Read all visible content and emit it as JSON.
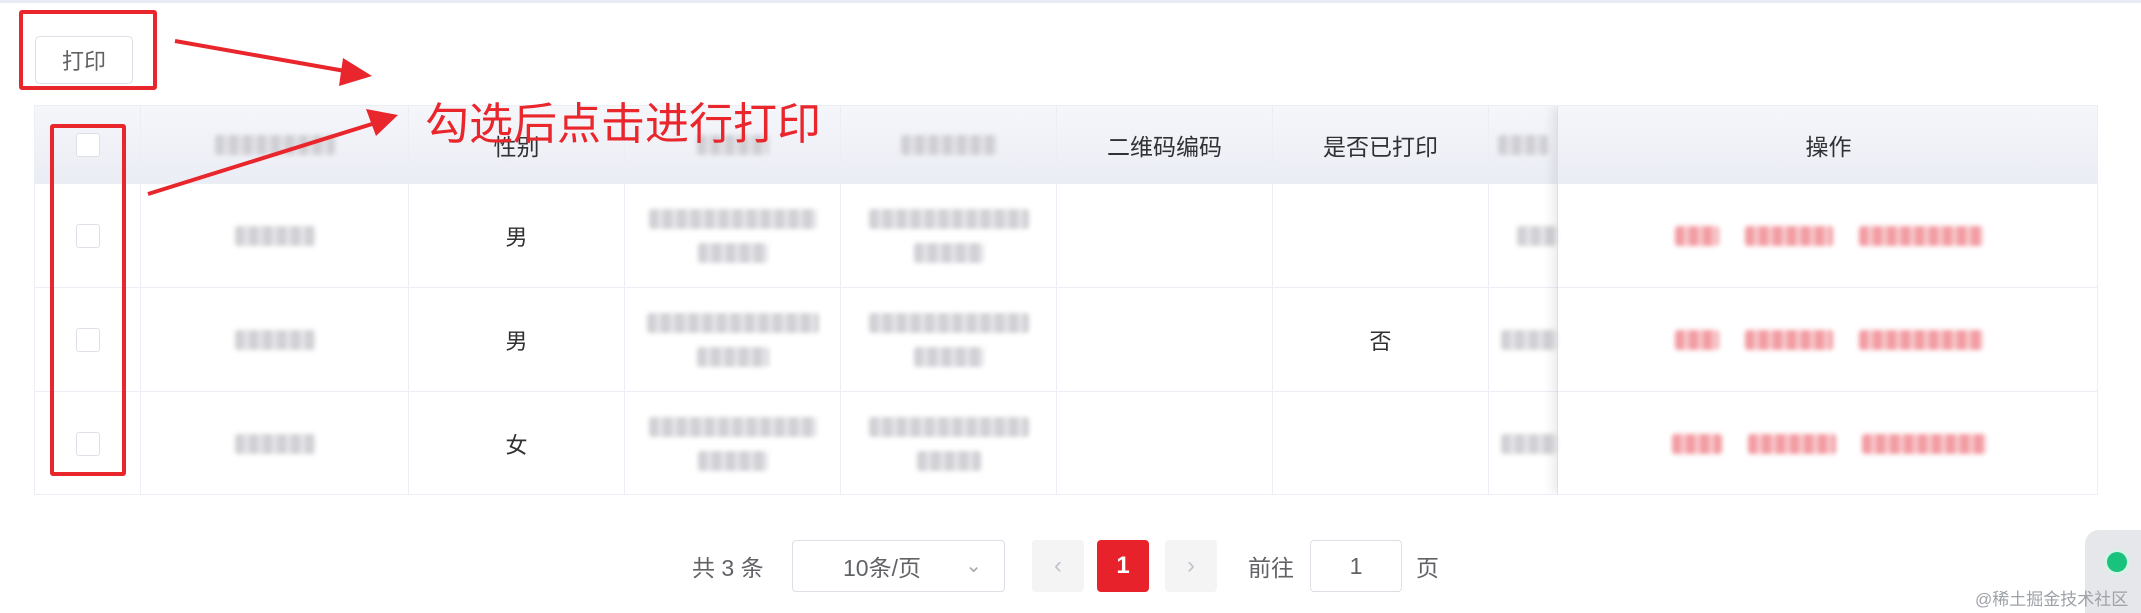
{
  "toolbar": {
    "print_label": "打印"
  },
  "table": {
    "headers": [
      "",
      "",
      "性别",
      "",
      "",
      "二维码编码",
      "是否已打印",
      "",
      "操作"
    ],
    "rows": [
      {
        "gender": "男",
        "qr_code": "",
        "printed": ""
      },
      {
        "gender": "男",
        "qr_code": "",
        "printed": "否"
      },
      {
        "gender": "女",
        "qr_code": "",
        "printed": ""
      }
    ]
  },
  "annotation": {
    "text": "勾选后点击进行打印",
    "color": "#e8262c"
  },
  "pagination": {
    "total_text": "共 3 条",
    "page_size": "10条/页",
    "prev_icon": "‹",
    "current_page": "1",
    "next_icon": "›",
    "goto_label": "前往",
    "goto_value": "1",
    "page_suffix": "页"
  },
  "watermark": "@稀土掘金技术社区",
  "colors": {
    "accent": "#e8222a",
    "status": "#19c37d"
  }
}
